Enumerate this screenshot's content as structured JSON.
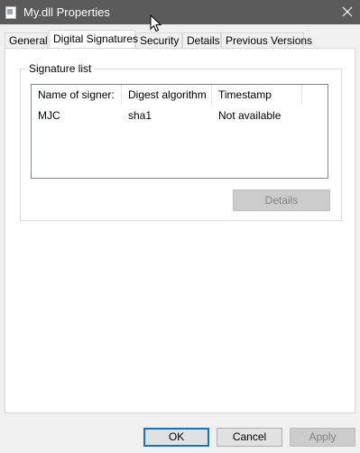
{
  "window": {
    "title": "My.dll Properties",
    "icon": "dll-file-icon",
    "close_icon": "close-icon"
  },
  "tabs": [
    {
      "label": "General",
      "active": false
    },
    {
      "label": "Digital Signatures",
      "active": true
    },
    {
      "label": "Security",
      "active": false
    },
    {
      "label": "Details",
      "active": false
    },
    {
      "label": "Previous Versions",
      "active": false
    }
  ],
  "signature_list": {
    "group_label": "Signature list",
    "columns": [
      "Name of signer:",
      "Digest algorithm",
      "Timestamp"
    ],
    "rows": [
      [
        "MJC",
        "sha1",
        "Not available"
      ]
    ],
    "details_button": "Details"
  },
  "buttons": {
    "ok": "OK",
    "cancel": "Cancel",
    "apply": "Apply"
  },
  "colors": {
    "titlebar": "#5b5b5b",
    "default_button_border": "#0078d7",
    "disabled_text": "#838383"
  }
}
